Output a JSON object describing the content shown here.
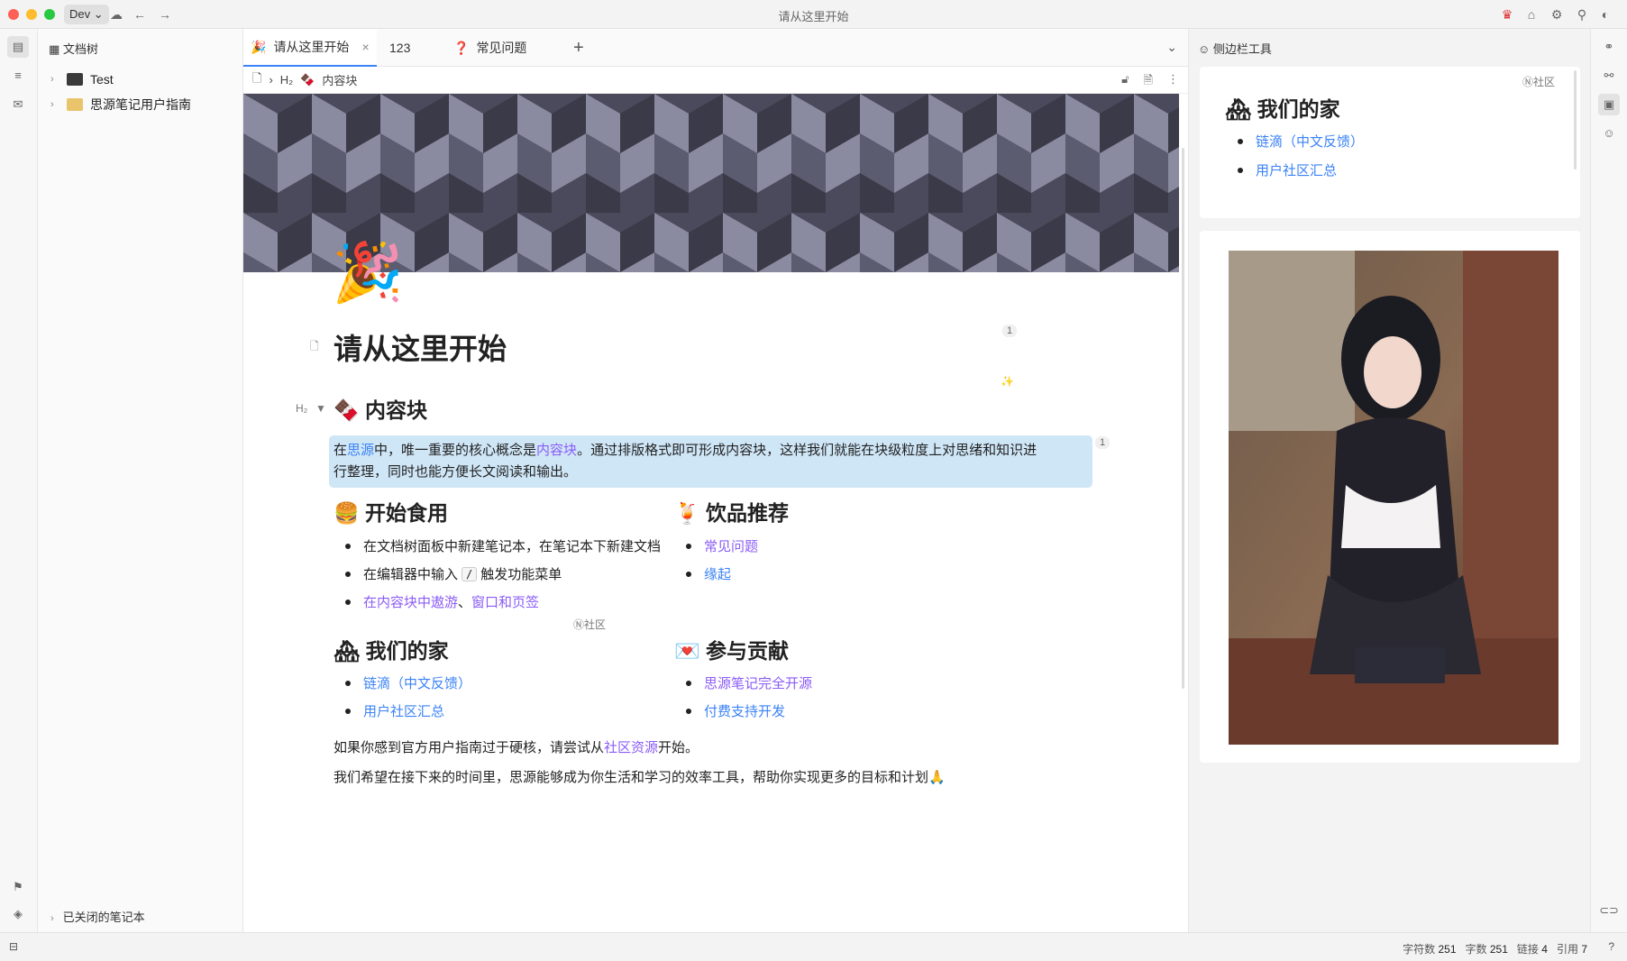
{
  "titlebar": {
    "workspace": "Dev",
    "title": "请从这里开始",
    "icons": [
      "cloud-icon",
      "back-icon",
      "forward-icon",
      "crown-icon",
      "home-icon",
      "plugin-icon",
      "search-icon",
      "mode-icon"
    ]
  },
  "filetree": {
    "header": "文档树",
    "notebooks": [
      {
        "label": "Test"
      },
      {
        "label": "思源笔记用户指南"
      }
    ],
    "closed_label": "已关闭的笔记本"
  },
  "tabs": [
    {
      "label": "请从这里开始",
      "active": true
    },
    {
      "label": "123",
      "active": false
    },
    {
      "label": "常见问题",
      "active": false
    }
  ],
  "breadcrumb": {
    "heading_marker": "H₂",
    "item": "内容块"
  },
  "document": {
    "title": "请从这里开始",
    "section1": {
      "marker": "H₂",
      "heading": "内容块",
      "para_parts": [
        "在",
        "思源",
        "中，唯一重要的核心概念是",
        "内容块",
        "。通过排版格式即可形成内容块，这样我们就能在块级粒度上对思绪和知识进",
        "行整理，同时也能方便长文阅读和输出。"
      ]
    },
    "col_left_1": {
      "heading": "开始食用",
      "items": [
        "在文档树面板中新建笔记本，在笔记本下新建文档"
      ],
      "item2_before": "在编辑器中输入",
      "item2_key": "/",
      "item2_after": "触发功能菜单",
      "item3_link1": "在内容块中遨游",
      "item3_sep": "、",
      "item3_link2": "窗口和页签"
    },
    "col_right_1": {
      "heading": "饮品推荐",
      "items": [
        "常见问题",
        "缘起"
      ]
    },
    "community_label": "社区",
    "col_left_2": {
      "heading": "我们的家",
      "items": [
        "链滴（中文反馈）",
        "用户社区汇总"
      ]
    },
    "col_right_2": {
      "heading": "参与贡献",
      "items": [
        "思源笔记完全开源",
        "付费支持开发"
      ]
    },
    "para_community_before": "如果你感到官方用户指南过于硬核，请尝试从",
    "para_community_link": "社区资源",
    "para_community_after": "开始。",
    "para_final": "我们希望在接下来的时间里，思源能够成为你生活和学习的效率工具，帮助你实现更多的目标和计划🙏",
    "ref_count_title": "1",
    "ref_count_para": "1"
  },
  "sidebar": {
    "header": "侧边栏工具",
    "card_label": "社区",
    "card_heading": "我们的家",
    "card_items": [
      "链滴（中文反馈）",
      "用户社区汇总"
    ]
  },
  "statusbar": {
    "chars_label": "字符数",
    "chars": "251",
    "words_label": "字数",
    "words": "251",
    "links_label": "链接",
    "links": "4",
    "refs_label": "引用",
    "refs": "7"
  },
  "colors": {
    "accent": "#3b82f6",
    "link_purple": "#8b5cf6",
    "highlight": "#cfe6f7",
    "cover_dark": "#4a4a5c",
    "cover_light": "#8a8aa0"
  }
}
